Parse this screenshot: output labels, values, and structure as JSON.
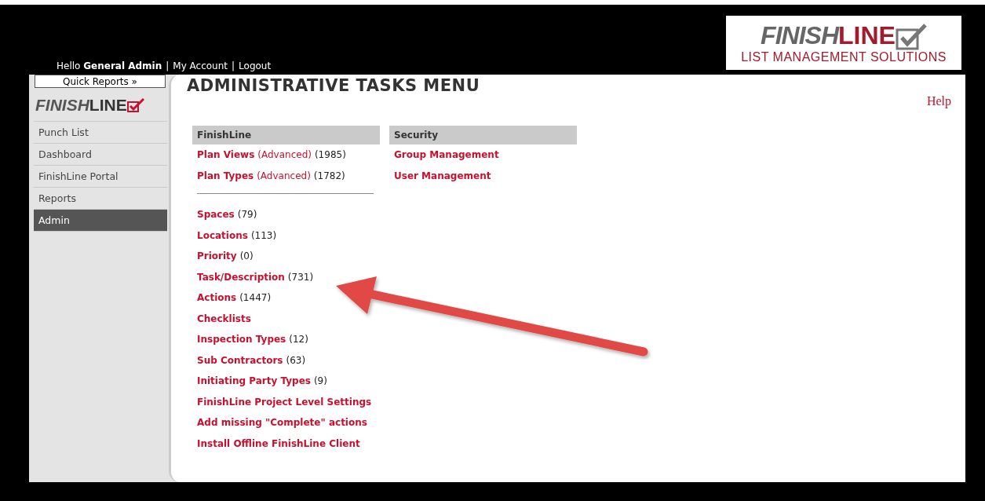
{
  "header": {
    "greeting": "Hello",
    "user": "General Admin",
    "links": [
      "My Account",
      "Logout"
    ],
    "separator": "|"
  },
  "logo": {
    "word1": "FINISH",
    "word2": "LINE",
    "tagline": "LIST MANAGEMENT SOLUTIONS"
  },
  "sidebar": {
    "quick_reports": "Quick Reports »",
    "logo": {
      "word1": "FINISH",
      "word2": "LINE"
    },
    "items": [
      {
        "label": "Punch List",
        "selected": false
      },
      {
        "label": "Dashboard",
        "selected": false
      },
      {
        "label": "FinishLine Portal",
        "selected": false
      },
      {
        "label": "Reports",
        "selected": false
      },
      {
        "label": "Admin",
        "selected": true
      }
    ]
  },
  "page": {
    "title": "ADMINISTRATIVE TASKS MENU",
    "help": "Help"
  },
  "sections": [
    {
      "header": "FinishLine",
      "top_links": [
        {
          "label": "Plan Views",
          "advanced": "(Advanced)",
          "count": "(1985)"
        },
        {
          "label": "Plan Types",
          "advanced": "(Advanced)",
          "count": "(1782)"
        }
      ],
      "links": [
        {
          "label": "Spaces",
          "count": "(79)"
        },
        {
          "label": "Locations",
          "count": "(113)"
        },
        {
          "label": "Priority",
          "count": "(0)"
        },
        {
          "label": "Task/Description",
          "count": "(731)"
        },
        {
          "label": "Actions",
          "count": "(1447)"
        },
        {
          "label": "Checklists"
        },
        {
          "label": "Inspection Types",
          "count": "(12)"
        },
        {
          "label": "Sub Contractors",
          "count": "(63)"
        },
        {
          "label": "Initiating Party Types",
          "count": "(9)"
        },
        {
          "label": "FinishLine Project Level Settings"
        },
        {
          "label": "Add missing \"Complete\" actions"
        },
        {
          "label": "Install Offline FinishLine Client"
        }
      ]
    },
    {
      "header": "Security",
      "top_links": [
        {
          "label": "Group Management"
        },
        {
          "label": "User Management"
        }
      ]
    }
  ]
}
